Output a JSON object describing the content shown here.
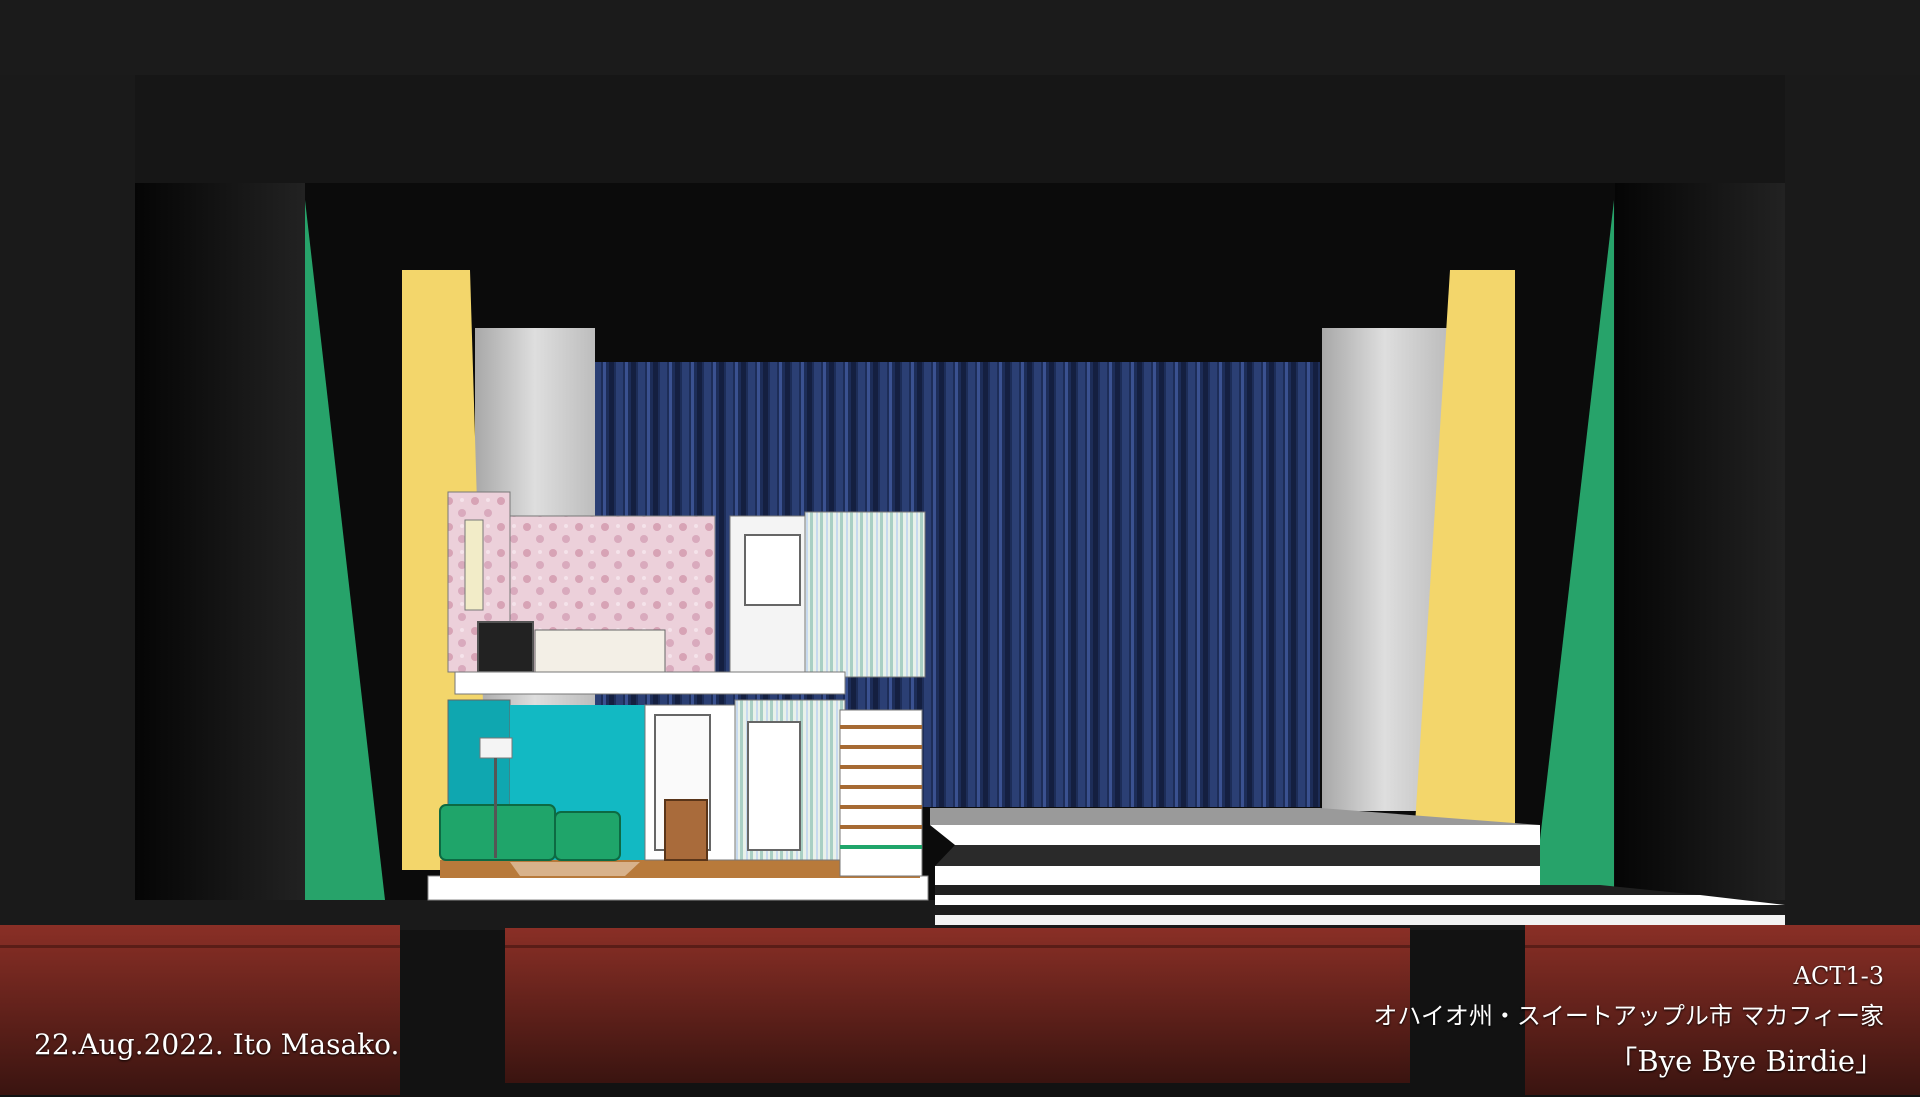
{
  "credit": "22.Aug.2022. Ito Masako.",
  "act": "ACT1-3",
  "location": "オハイオ州・スイートアップル市 マカフィー家",
  "title": "「Bye Bye Birdie」",
  "colors": {
    "proscenium": "#151515",
    "backdrop_curtain": "#1d2d58",
    "leg_green": "#27a36a",
    "leg_yellow": "#f3d66b",
    "flat_grey": "#cfcfcf",
    "seat_red": "#8a2f26",
    "wall_pink": "#e8c6d2",
    "wall_teal": "#12b9c3",
    "sofa_green": "#1fa56a",
    "stripe_wallpaper": "#cfe3d8"
  }
}
